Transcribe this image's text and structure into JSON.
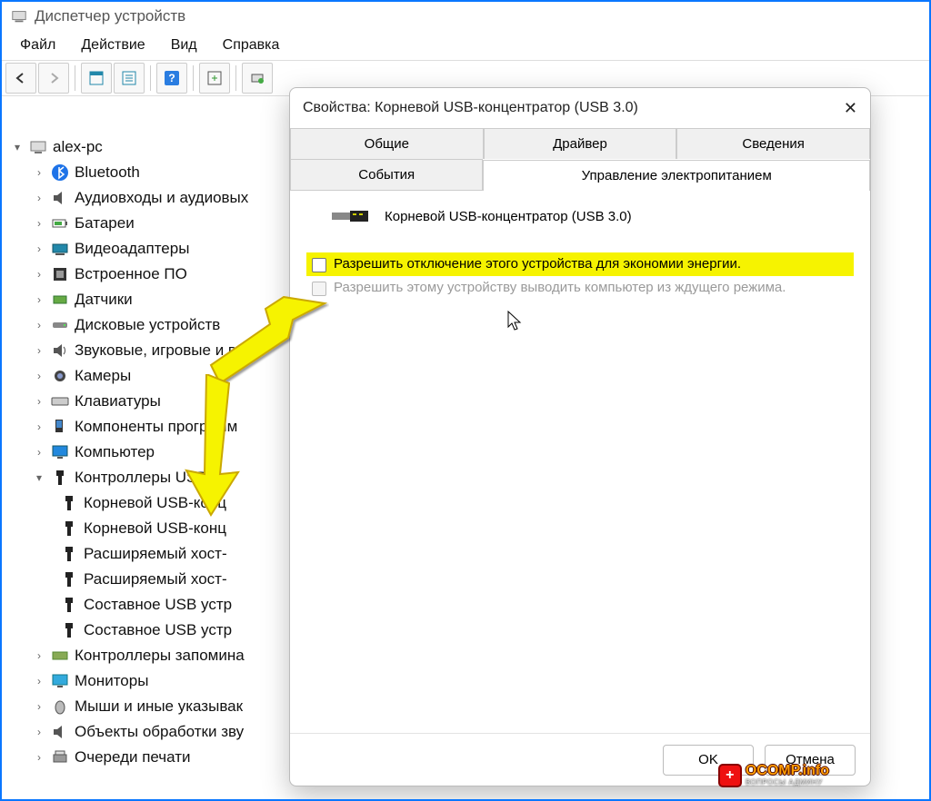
{
  "window": {
    "title": "Диспетчер устройств"
  },
  "menubar": [
    "Файл",
    "Действие",
    "Вид",
    "Справка"
  ],
  "tree": {
    "root": "alex-pc",
    "items": [
      "Bluetooth",
      "Аудиовходы и аудиовых",
      "Батареи",
      "Видеоадаптеры",
      "Встроенное ПО",
      "Датчики",
      "Дисковые устройств",
      "Звуковые, игровые и ви",
      "Камеры",
      "Клавиатуры",
      "Компоненты программ",
      "Компьютер",
      "Контроллеры USB",
      "Контроллеры запомина",
      "Мониторы",
      "Мыши и иные указывак",
      "Объекты обработки зву",
      "Очереди печати"
    ],
    "usb_children": [
      "Корневой USB-конц",
      "Корневой USB-конц",
      "Расширяемый хост-",
      "Расширяемый хост-",
      "Составное USB устр",
      "Составное USB устр"
    ]
  },
  "dialog": {
    "title": "Свойства: Корневой USB-концентратор (USB 3.0)",
    "tabs_row1": [
      "Общие",
      "Драйвер",
      "Сведения"
    ],
    "tabs_row2": [
      "События",
      "Управление электропитанием"
    ],
    "device_name": "Корневой USB-концентратор (USB 3.0)",
    "option1": "Разрешить отключение этого устройства для экономии энергии.",
    "option2": "Разрешить этому устройству выводить компьютер из ждущего режима.",
    "ok": "OK",
    "cancel": "Отмена"
  },
  "watermark": {
    "text": "OCOMP.info",
    "sub": "ВОПРОСЫ АДМИНУ"
  }
}
